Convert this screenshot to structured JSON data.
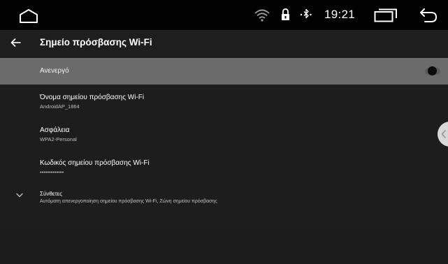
{
  "status_bar": {
    "clock": "19:21",
    "icons": [
      "home-icon",
      "wifi-icon",
      "lock-icon",
      "bluetooth-icon",
      "recent-apps-icon",
      "back-icon"
    ]
  },
  "header": {
    "title": "Σημείο πρόσβασης Wi-Fi"
  },
  "toggle": {
    "label": "Ανενεργό",
    "state": "off"
  },
  "settings": [
    {
      "title": "Όνομα σημείου πρόσβασης Wi-Fi",
      "value": "AndroidAP_1864"
    },
    {
      "title": "Ασφάλεια",
      "value": "WPA2-Personal"
    },
    {
      "title": "Κωδικός σημείου πρόσβασης Wi-Fi",
      "value": "•••••••••••••"
    },
    {
      "title": "Σύνθετες",
      "value": "Αυτόματη απενεργοποίηση σημείου πρόσβασης Wi-Fi, Ζώνη σημείου πρόσβασης"
    }
  ],
  "colors": {
    "background": "#1d1d1d",
    "status_bar": "#020202",
    "toggle_bar": "#6b6b6b"
  }
}
